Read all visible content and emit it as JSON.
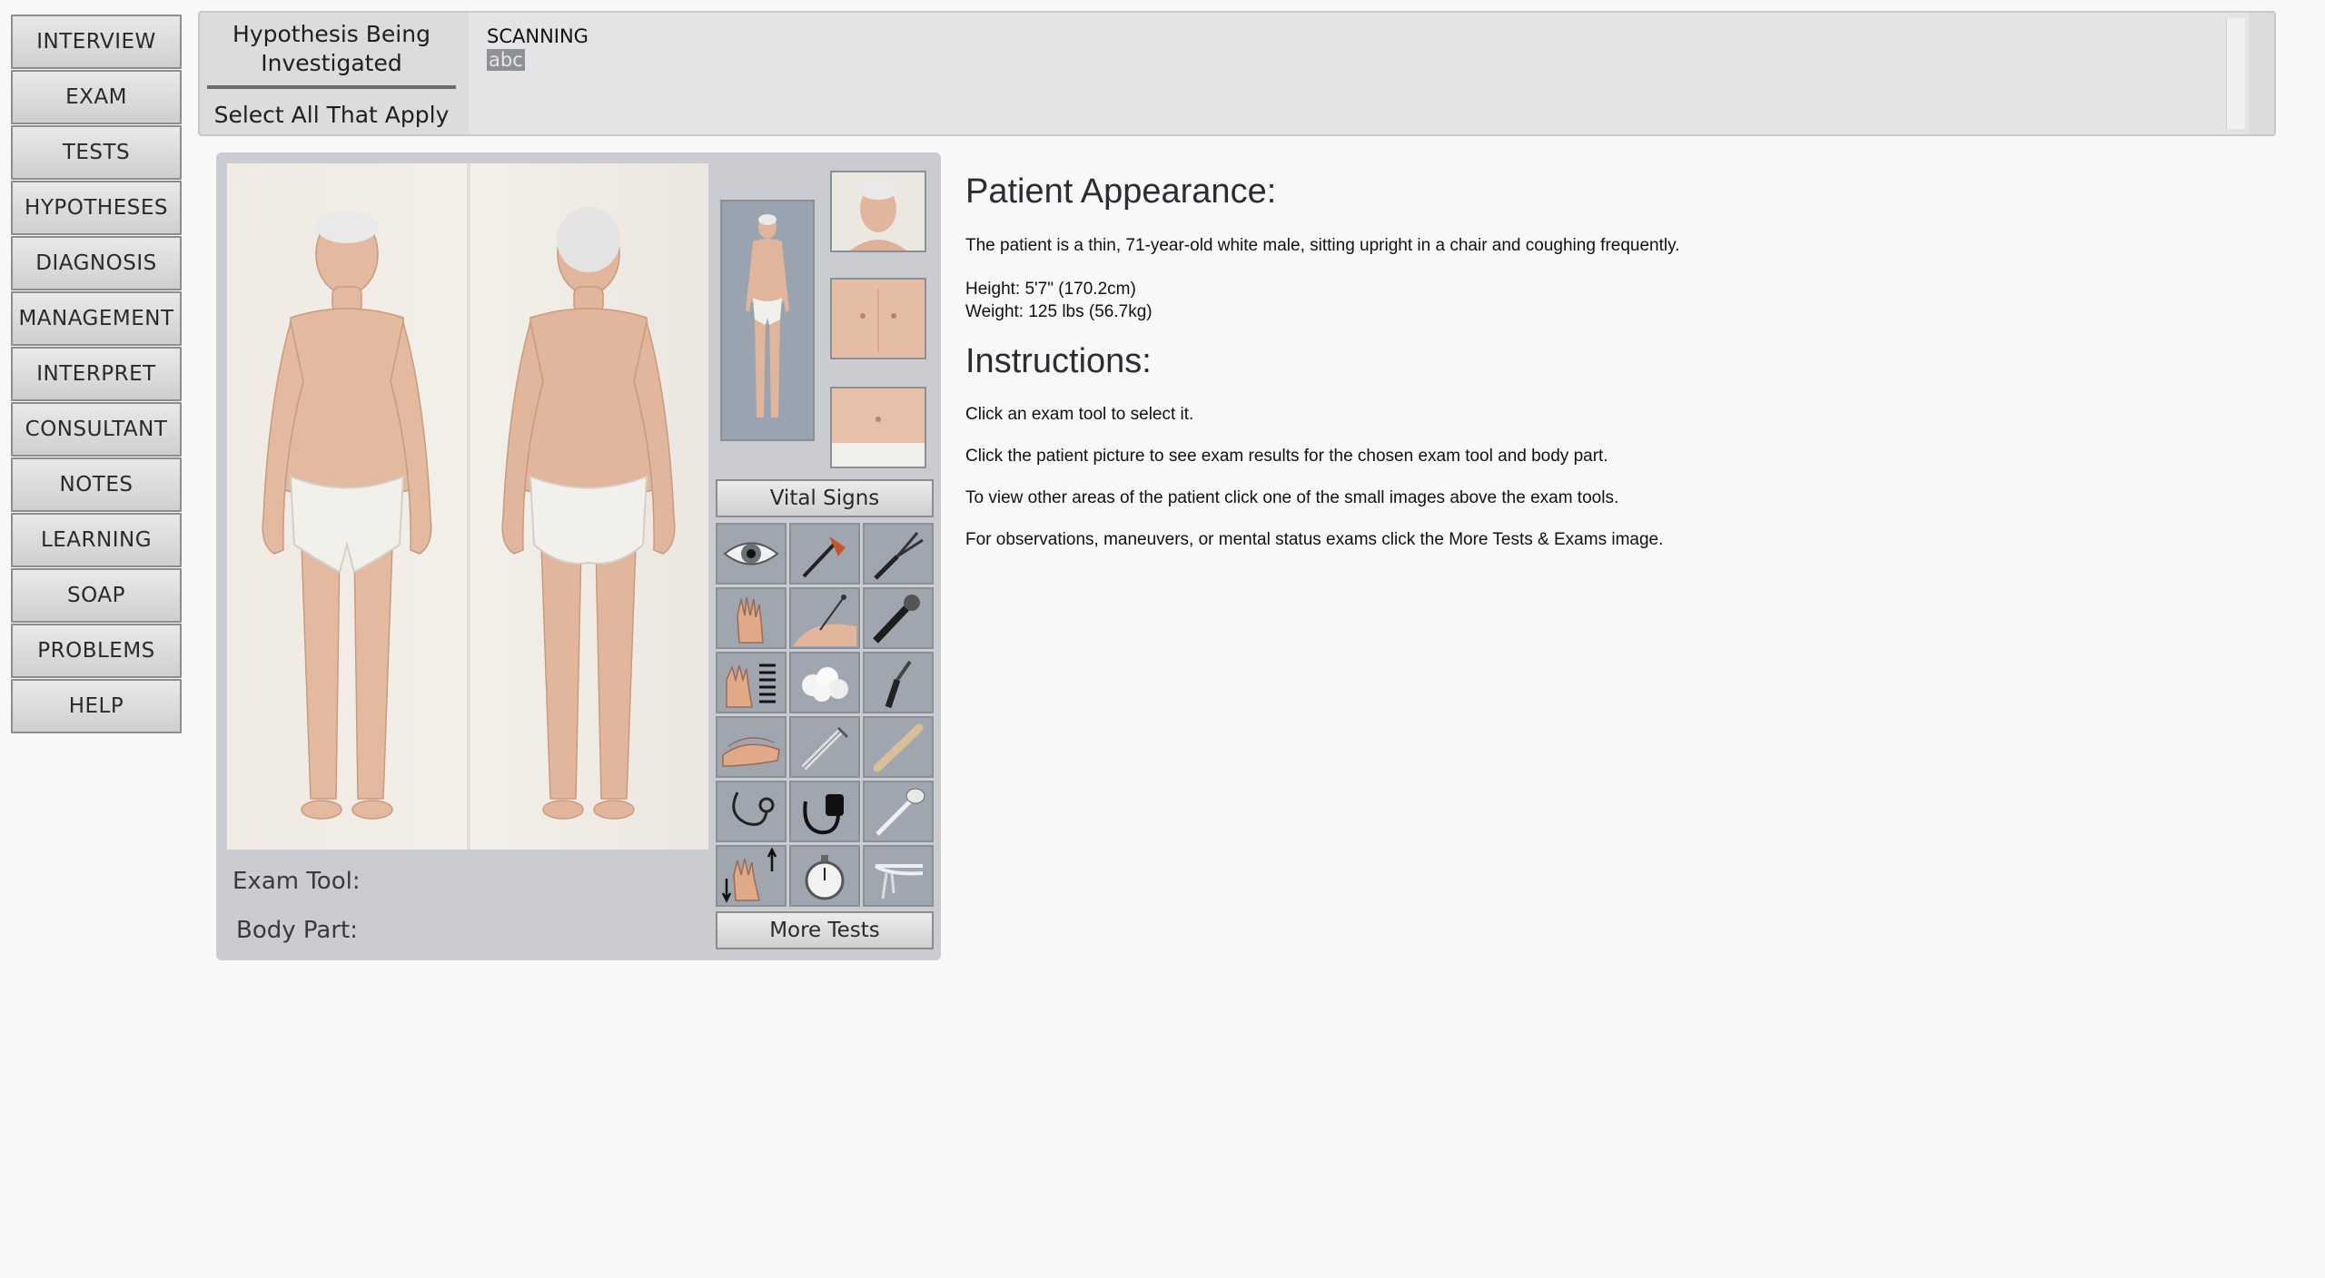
{
  "nav": {
    "items": [
      {
        "label": "INTERVIEW"
      },
      {
        "label": "EXAM"
      },
      {
        "label": "TESTS"
      },
      {
        "label": "HYPOTHESES"
      },
      {
        "label": "DIAGNOSIS"
      },
      {
        "label": "MANAGEMENT"
      },
      {
        "label": "INTERPRET"
      },
      {
        "label": "CONSULTANT"
      },
      {
        "label": "NOTES"
      },
      {
        "label": "LEARNING"
      },
      {
        "label": "SOAP"
      },
      {
        "label": "PROBLEMS"
      },
      {
        "label": "HELP"
      }
    ]
  },
  "hypothesis": {
    "tab_investigated": "Hypothesis Being Investigated",
    "tab_select": "Select All That Apply",
    "current": "SCANNING",
    "highlight": "abc"
  },
  "exam": {
    "vital_signs": "Vital Signs",
    "more_tests": "More Tests",
    "exam_tool_label": "Exam Tool:",
    "body_part_label": "Body Part:",
    "tools": [
      {
        "icon": "eye-icon"
      },
      {
        "icon": "reflex-hammer-icon"
      },
      {
        "icon": "tuning-fork-icon"
      },
      {
        "icon": "hand-palpation-icon"
      },
      {
        "icon": "pin-icon"
      },
      {
        "icon": "penlight-icon"
      },
      {
        "icon": "hand-scale-icon"
      },
      {
        "icon": "cotton-balls-icon"
      },
      {
        "icon": "otoscope-icon"
      },
      {
        "icon": "hands-percussion-icon"
      },
      {
        "icon": "syringe-icon"
      },
      {
        "icon": "tongue-depressor-icon"
      },
      {
        "icon": "stethoscope-icon"
      },
      {
        "icon": "blood-pressure-cuff-icon"
      },
      {
        "icon": "thermometer-icon"
      },
      {
        "icon": "hand-up-down-icon"
      },
      {
        "icon": "stopwatch-icon"
      },
      {
        "icon": "speculum-icon"
      }
    ]
  },
  "info": {
    "appearance_title": "Patient Appearance:",
    "appearance_text": "The patient is a thin, 71-year-old white male, sitting upright in a chair and coughing frequently.",
    "height": "Height: 5'7\" (170.2cm)",
    "weight": "Weight: 125 lbs (56.7kg)",
    "instructions_title": "Instructions:",
    "instructions": [
      "Click an exam tool to select it.",
      "Click the patient picture to see exam results for the chosen exam tool and body part.",
      "To view other areas of the patient click one of the small images above the exam tools.",
      "For observations, maneuvers, or mental status exams click the More Tests & Exams image."
    ]
  }
}
